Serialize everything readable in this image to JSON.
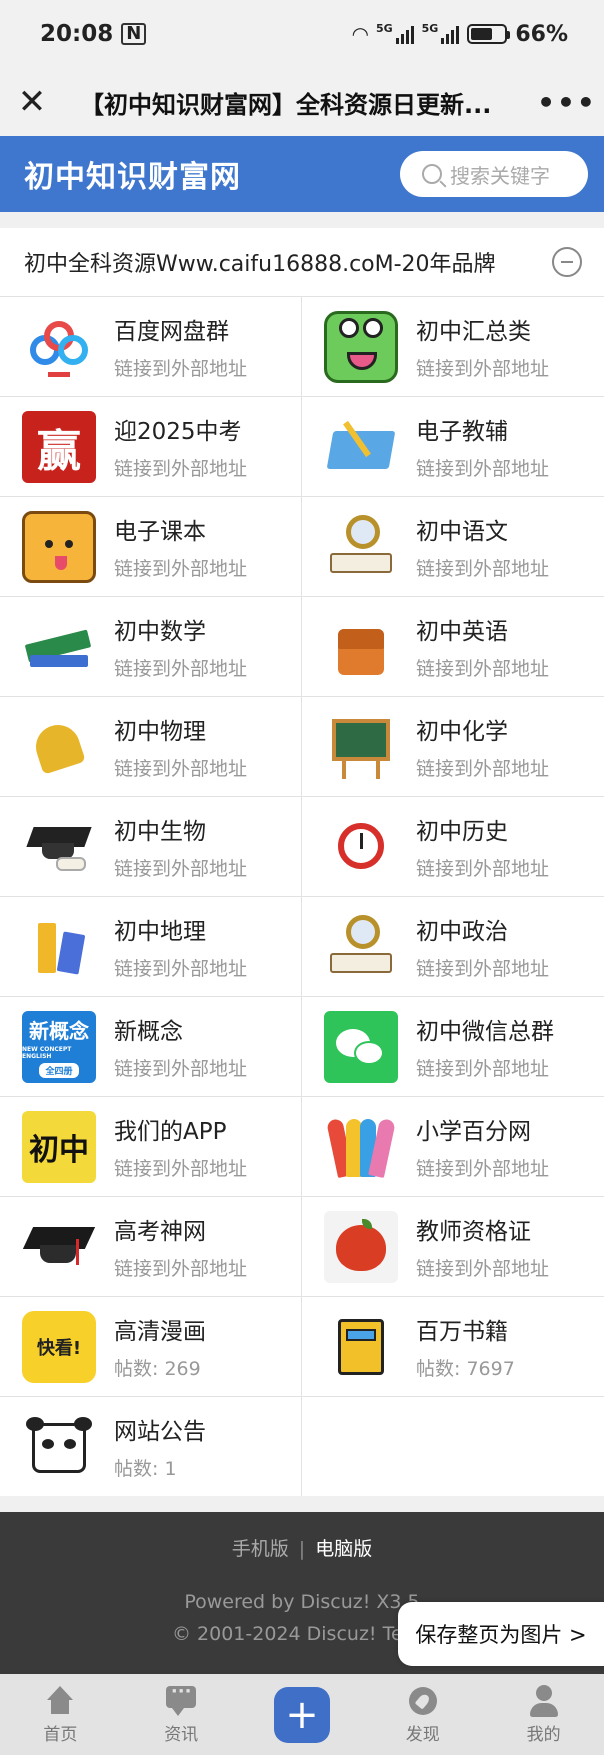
{
  "status_bar": {
    "time": "20:08",
    "nfc": "N",
    "net1": "5G",
    "net2": "5G",
    "battery": "66%",
    "battery_level": 0.66
  },
  "title_bar": {
    "title": "【初中知识财富网】全科资源日更新...",
    "close_icon": "close-icon",
    "more_icon": "more-icon"
  },
  "header": {
    "logo": "初中知识财富网",
    "search_placeholder": "搜索关键字"
  },
  "notice": {
    "text": "初中全科资源Www.caifu16888.coM-20年品牌"
  },
  "forums": [
    {
      "name": "百度网盘群",
      "desc": "链接到外部地址",
      "icon": "baidu-netdisk-icon"
    },
    {
      "name": "初中汇总类",
      "desc": "链接到外部地址",
      "icon": "frog-icon"
    },
    {
      "name": "迎2025中考",
      "desc": "链接到外部地址",
      "icon": "ying-icon",
      "icon_text": "赢"
    },
    {
      "name": "电子教辅",
      "desc": "链接到外部地址",
      "icon": "open-book-icon"
    },
    {
      "name": "电子课本",
      "desc": "链接到外部地址",
      "icon": "cat-icon"
    },
    {
      "name": "初中语文",
      "desc": "链接到外部地址",
      "icon": "magnifier-book-icon"
    },
    {
      "name": "初中数学",
      "desc": "链接到外部地址",
      "icon": "books-icon"
    },
    {
      "name": "初中英语",
      "desc": "链接到外部地址",
      "icon": "schoolbag-icon"
    },
    {
      "name": "初中物理",
      "desc": "链接到外部地址",
      "icon": "bell-icon"
    },
    {
      "name": "初中化学",
      "desc": "链接到外部地址",
      "icon": "chalkboard-icon"
    },
    {
      "name": "初中生物",
      "desc": "链接到外部地址",
      "icon": "grad-cap-diploma-icon"
    },
    {
      "name": "初中历史",
      "desc": "链接到外部地址",
      "icon": "alarm-clock-icon"
    },
    {
      "name": "初中地理",
      "desc": "链接到外部地址",
      "icon": "pencils-icon"
    },
    {
      "name": "初中政治",
      "desc": "链接到外部地址",
      "icon": "magnifier-book-icon"
    },
    {
      "name": "新概念",
      "desc": "链接到外部地址",
      "icon": "new-concept-icon",
      "icon_text": "新概念",
      "icon_sub": "NEW CONCEPT ENGLISH",
      "icon_tag": "全四册"
    },
    {
      "name": "初中微信总群",
      "desc": "链接到外部地址",
      "icon": "wechat-icon"
    },
    {
      "name": "我们的APP",
      "desc": "链接到外部地址",
      "icon": "chuzhong-app-icon",
      "icon_text": "初中"
    },
    {
      "name": "小学百分网",
      "desc": "链接到外部地址",
      "icon": "crayons-icon"
    },
    {
      "name": "高考神网",
      "desc": "链接到外部地址",
      "icon": "mortarboard-icon"
    },
    {
      "name": "教师资格证",
      "desc": "链接到外部地址",
      "icon": "apple-icon"
    },
    {
      "name": "高清漫画",
      "desc": "帖数: 269",
      "icon": "kuaikan-icon",
      "icon_text": "快看!"
    },
    {
      "name": "百万书籍",
      "desc": "帖数: 7697",
      "icon": "notebook-icon"
    },
    {
      "name": "网站公告",
      "desc": "帖数: 1",
      "icon": "panda-icon"
    }
  ],
  "footer": {
    "mobile": "手机版",
    "separator": "|",
    "desktop": "电脑版",
    "powered": "Powered by Discuz! X3.5",
    "copyright": "© 2001-2024 Discuz! Te"
  },
  "save_button": "保存整页为图片 >",
  "bottom_nav": [
    {
      "label": "首页",
      "icon": "home-icon"
    },
    {
      "label": "资讯",
      "icon": "chat-icon"
    },
    {
      "label": "",
      "icon": "plus-icon"
    },
    {
      "label": "发现",
      "icon": "compass-icon"
    },
    {
      "label": "我的",
      "icon": "user-icon"
    }
  ],
  "colors": {
    "brand_blue": "#3f77cf",
    "footer_bg": "#3a3a3a",
    "link_gray": "#999999"
  }
}
